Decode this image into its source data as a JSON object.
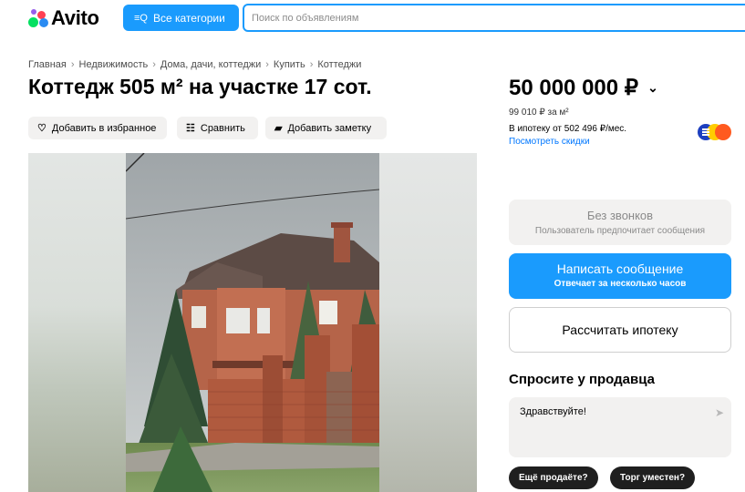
{
  "header": {
    "logo_text": "Avito",
    "categories_label": "Все категории",
    "categories_icon": "list-search-icon",
    "search_placeholder": "Поиск по объявлениям"
  },
  "breadcrumbs": [
    "Главная",
    "Недвижимость",
    "Дома, дачи, коттеджи",
    "Купить",
    "Коттеджи"
  ],
  "listing": {
    "title": "Коттедж 505 м² на участке 17 сот."
  },
  "actions": {
    "favorite_label": "Добавить в избранное",
    "favorite_icon": "heart-icon",
    "compare_label": "Сравнить",
    "compare_icon": "compare-icon",
    "note_label": "Добавить заметку",
    "note_icon": "note-icon"
  },
  "price": {
    "amount": "50 000 000 ₽",
    "per_m2": "99 010 ₽ за м²",
    "mortgage": "В ипотеку от 502 496 ₽/мес.",
    "discounts_link": "Посмотреть скидки"
  },
  "contact": {
    "no_calls_title": "Без звонков",
    "no_calls_subtitle": "Пользователь предпочитает сообщения",
    "write_title": "Написать сообщение",
    "write_subtitle": "Отвечает за несколько часов",
    "mortgage_calc": "Рассчитать ипотеку"
  },
  "ask": {
    "title": "Спросите у продавца",
    "message_value": "Здравствуйте!",
    "chips": [
      "Ещё продаёте?",
      "Торг уместен?"
    ]
  },
  "colors": {
    "accent_blue": "#1a9bfd",
    "button_gray": "#f2f1f0",
    "logo_green": "#04e061",
    "logo_blue": "#2a8bf2",
    "logo_red": "#ff4053",
    "logo_purple": "#965eeb"
  }
}
